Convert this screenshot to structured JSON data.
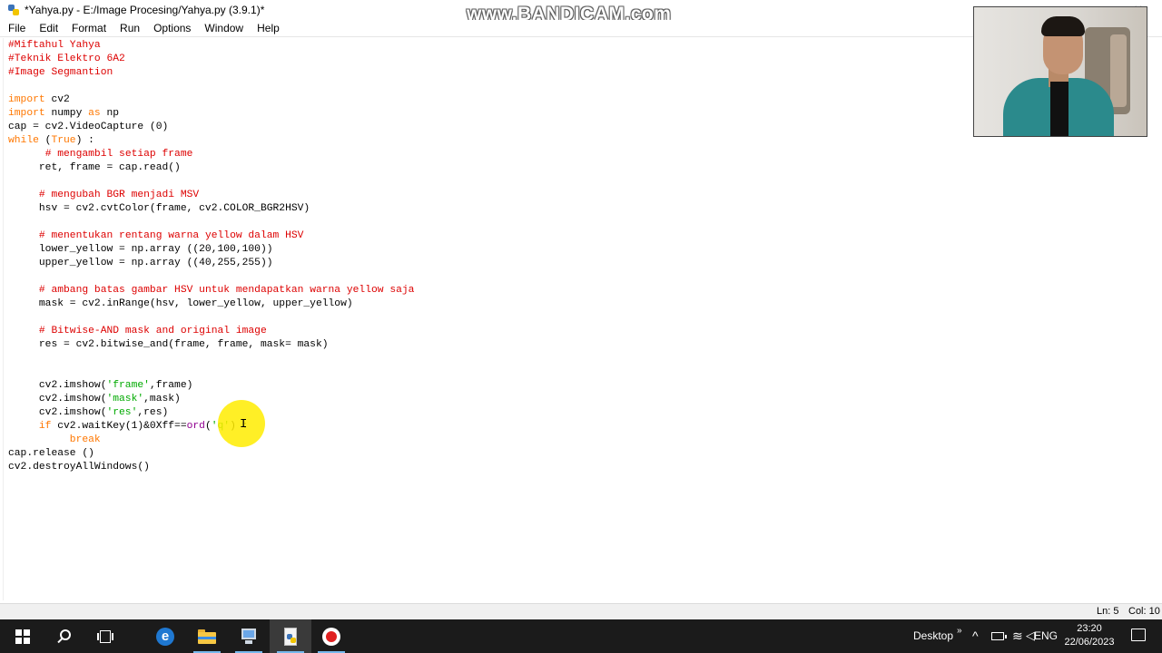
{
  "window": {
    "title": "*Yahya.py - E:/Image Procesing/Yahya.py (3.9.1)*",
    "controls": [
      "—",
      "□",
      "✕"
    ]
  },
  "watermark": "www.BANDICAM.com",
  "menu": [
    "File",
    "Edit",
    "Format",
    "Run",
    "Options",
    "Window",
    "Help"
  ],
  "code_lines": [
    [
      {
        "t": "#Miftahul Yahya",
        "c": "comment"
      }
    ],
    [
      {
        "t": "#Teknik Elektro 6A2",
        "c": "comment"
      }
    ],
    [
      {
        "t": "#Image Segmantion",
        "c": "comment"
      }
    ],
    [],
    [
      {
        "t": "import",
        "c": "keyword"
      },
      {
        "t": " cv2"
      }
    ],
    [
      {
        "t": "import",
        "c": "keyword"
      },
      {
        "t": " numpy "
      },
      {
        "t": "as",
        "c": "keyword"
      },
      {
        "t": " np"
      }
    ],
    [
      {
        "t": "cap = cv2.VideoCapture (0)"
      }
    ],
    [
      {
        "t": "while",
        "c": "keyword"
      },
      {
        "t": " ("
      },
      {
        "t": "True",
        "c": "keyword"
      },
      {
        "t": ") :"
      }
    ],
    [
      {
        "t": "      "
      },
      {
        "t": "# mengambil setiap frame",
        "c": "comment"
      }
    ],
    [
      {
        "t": "     ret, frame = cap.read()"
      }
    ],
    [],
    [
      {
        "t": "     "
      },
      {
        "t": "# mengubah BGR menjadi MSV",
        "c": "comment"
      }
    ],
    [
      {
        "t": "     hsv = cv2.cvtColor(frame, cv2.COLOR_BGR2HSV)"
      }
    ],
    [],
    [
      {
        "t": "     "
      },
      {
        "t": "# menentukan rentang warna yellow dalam HSV",
        "c": "comment"
      }
    ],
    [
      {
        "t": "     lower_yellow = np.array ((20,100,100))"
      }
    ],
    [
      {
        "t": "     upper_yellow = np.array ((40,255,255))"
      }
    ],
    [],
    [
      {
        "t": "     "
      },
      {
        "t": "# ambang batas gambar HSV untuk mendapatkan warna yellow saja",
        "c": "comment"
      }
    ],
    [
      {
        "t": "     mask = cv2.inRange(hsv, lower_yellow, upper_yellow)"
      }
    ],
    [],
    [
      {
        "t": "     "
      },
      {
        "t": "# Bitwise-AND mask and original image",
        "c": "comment"
      }
    ],
    [
      {
        "t": "     res = cv2.bitwise_and(frame, frame, mask= mask)"
      }
    ],
    [],
    [],
    [
      {
        "t": "     cv2.imshow("
      },
      {
        "t": "'frame'",
        "c": "string"
      },
      {
        "t": ",frame)"
      }
    ],
    [
      {
        "t": "     cv2.imshow("
      },
      {
        "t": "'mask'",
        "c": "string"
      },
      {
        "t": ",mask)"
      }
    ],
    [
      {
        "t": "     cv2.imshow("
      },
      {
        "t": "'res'",
        "c": "string"
      },
      {
        "t": ",res)"
      }
    ],
    [
      {
        "t": "     "
      },
      {
        "t": "if",
        "c": "keyword"
      },
      {
        "t": " cv2.waitKey(1)&0Xff=="
      },
      {
        "t": "ord",
        "c": "builtin"
      },
      {
        "t": "("
      },
      {
        "t": "'q'",
        "c": "string"
      },
      {
        "t": ") :"
      }
    ],
    [
      {
        "t": "          "
      },
      {
        "t": "break",
        "c": "keyword"
      }
    ],
    [
      {
        "t": "cap.release ()"
      }
    ],
    [
      {
        "t": "cv2.destroyAllWindows()"
      }
    ]
  ],
  "code_colors": {
    "comment": "#dd0000",
    "keyword": "#ff7700",
    "string": "#00aa00",
    "builtin": "#900090"
  },
  "status": {
    "line": "Ln: 5",
    "col": "Col: 10"
  },
  "taskbar": {
    "apps": [
      "start-icon",
      "search-icon",
      "task-view-icon",
      "edge-icon",
      "file-explorer-icon",
      "remote-desktop-icon",
      "python-idle-icon",
      "bandicam-record-icon"
    ],
    "desktop_label": "Desktop",
    "overflow": "»",
    "language": "ENG",
    "time": "23:20",
    "date": "22/06/2023"
  },
  "webcam_label": "webcam-overlay"
}
